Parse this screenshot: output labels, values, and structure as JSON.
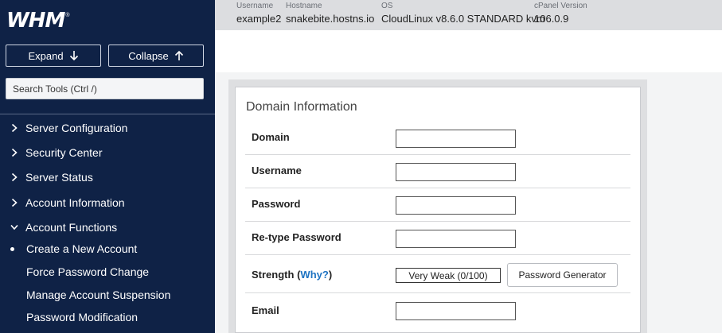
{
  "sidebar": {
    "logo_text": "WHM",
    "logo_mark": "®",
    "expand_label": "Expand",
    "collapse_label": "Collapse",
    "search_placeholder": "Search Tools (Ctrl /)",
    "sections": [
      {
        "label": "Server Configuration",
        "icon": "chevron-right-icon"
      },
      {
        "label": "Security Center",
        "icon": "chevron-right-icon"
      },
      {
        "label": "Server Status",
        "icon": "chevron-right-icon"
      },
      {
        "label": "Account Information",
        "icon": "chevron-right-icon"
      },
      {
        "label": "Account Functions",
        "icon": "chevron-down-icon"
      }
    ],
    "sub_items": [
      {
        "label": "Create a New Account",
        "active": true
      },
      {
        "label": "Force Password Change",
        "active": false
      },
      {
        "label": "Manage Account Suspension",
        "active": false
      },
      {
        "label": "Password Modification",
        "active": false
      }
    ],
    "colors": {
      "background": "#0f2246",
      "text": "#ffffff"
    }
  },
  "topbar": {
    "username_key": "Username",
    "username_value": "example2",
    "hostname_key": "Hostname",
    "hostname_value": "snakebite.hostns.io",
    "os_key": "OS",
    "os_value": "CloudLinux v8.6.0 STANDARD kvm",
    "version_key": "cPanel Version",
    "version_value": "106.0.9"
  },
  "form": {
    "section_title": "Domain Information",
    "domain_label": "Domain",
    "username_label": "Username",
    "password_label": "Password",
    "retype_label": "Re-type Password",
    "strength_label": "Strength",
    "strength_open": "(",
    "strength_why": "Why?",
    "strength_close": ")",
    "strength_value": "Very Weak (0/100)",
    "generator_label": "Password Generator",
    "email_label": "Email",
    "link_color": "#1d73c2"
  }
}
